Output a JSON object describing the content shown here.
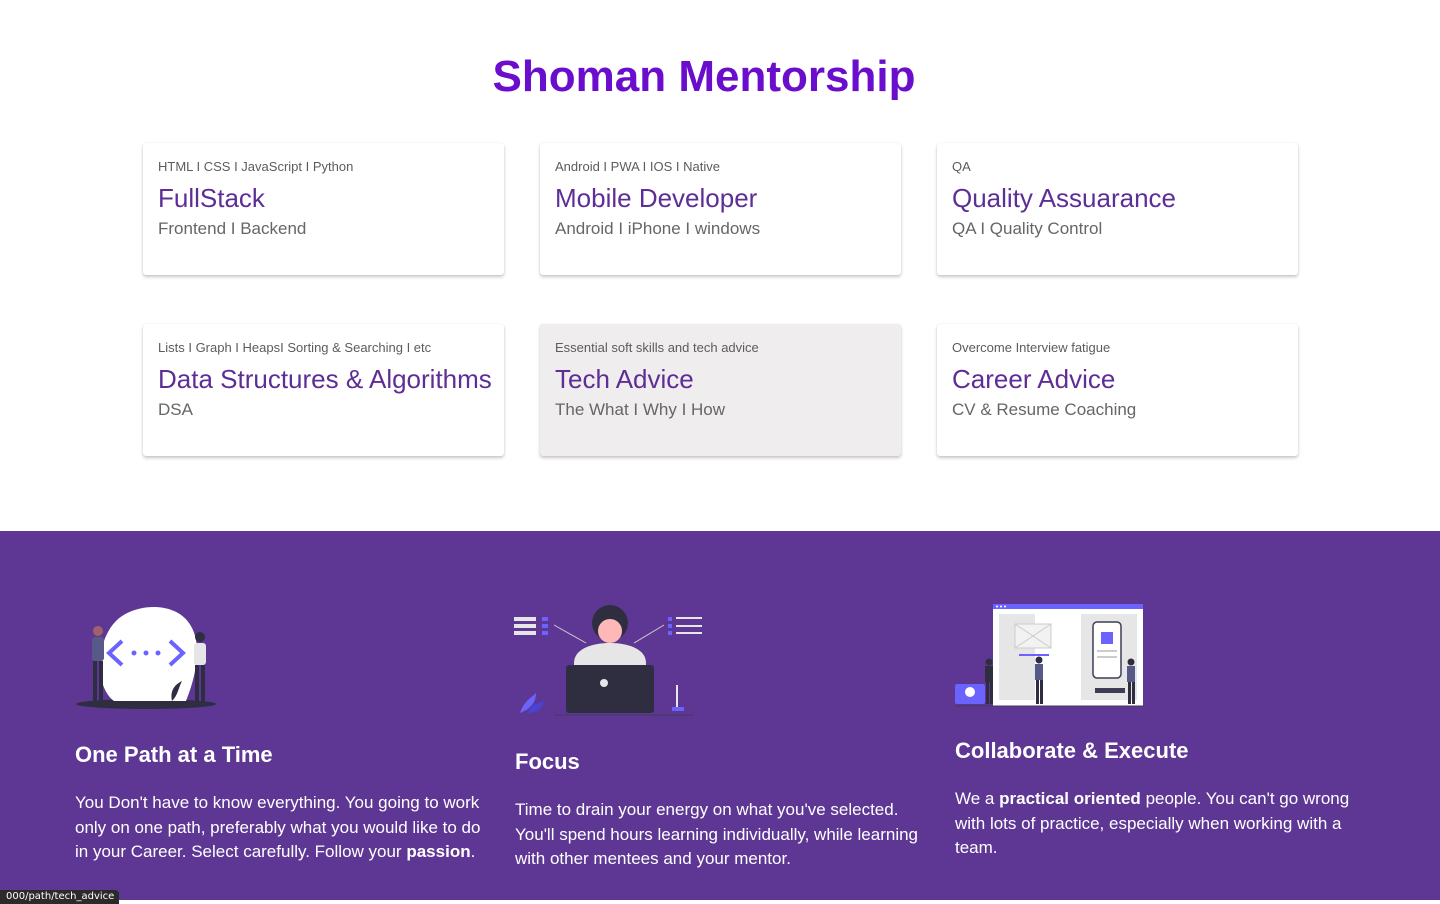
{
  "page": {
    "title": "Shoman Mentorship"
  },
  "cards": [
    {
      "overline": "HTML I CSS I JavaScript I Python",
      "name": "FullStack",
      "sub": "Frontend I Backend"
    },
    {
      "overline": "Android I PWA I IOS I Native",
      "name": "Mobile Developer",
      "sub": "Android I iPhone I windows"
    },
    {
      "overline": "QA",
      "name": "Quality Assuarance",
      "sub": "QA I Quality Control"
    },
    {
      "overline": "Lists I Graph I HeapsI Sorting & Searching I etc",
      "name": "Data Structures & Algorithms",
      "sub": "DSA"
    },
    {
      "overline": "Essential soft skills and tech advice",
      "name": "Tech Advice",
      "sub": "The What I Why I How"
    },
    {
      "overline": "Overcome Interview fatigue",
      "name": "Career Advice",
      "sub": "CV & Resume Coaching"
    }
  ],
  "features": [
    {
      "heading": "One Path at a Time",
      "text": "You Don't have to know everything. You going to work only on one path, preferably what you would like to do in your Career. Select carefully. Follow your",
      "bold": "passion",
      "after": "."
    },
    {
      "heading": "Focus",
      "text": "Time to drain your energy on what you've selected. You'll spend hours learning individually, while learning with other mentees and your mentor."
    },
    {
      "heading": "Collaborate & Execute",
      "before": "We a",
      "bold": "practical oriented",
      "text": "people. You can't go wrong with lots of practice, especially when working with a team."
    }
  ],
  "status": {
    "url": "000/path/tech_advice"
  },
  "colors": {
    "brand": "#6a0dcc",
    "card_title": "#5d2e96",
    "band": "#5e3794",
    "accent": "#6c63ff"
  }
}
